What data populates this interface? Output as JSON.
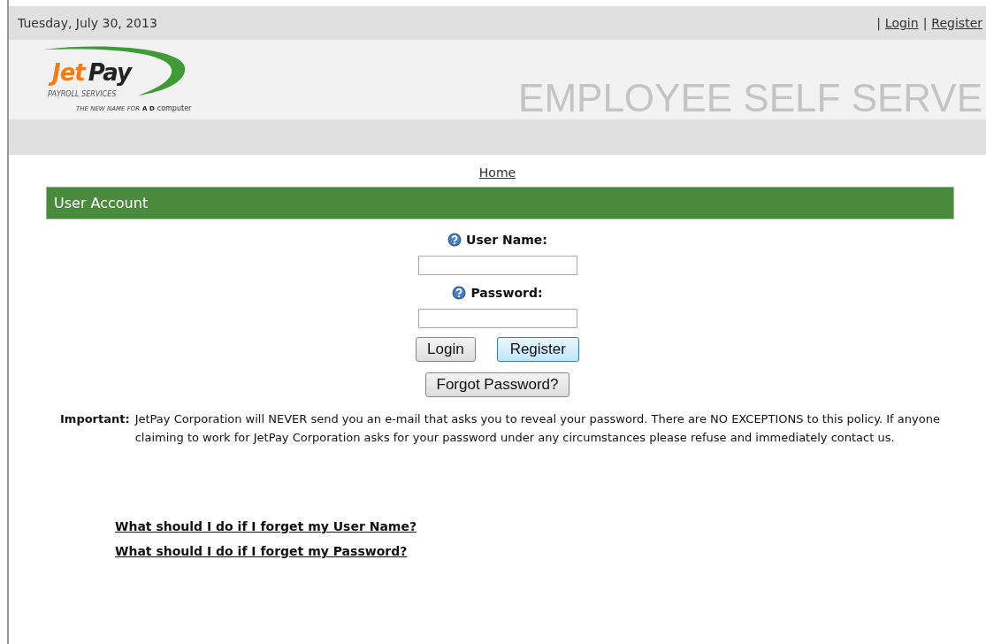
{
  "top_bar": {
    "date": "Tuesday, July 30, 2013",
    "separator_1": "|",
    "login_link": "Login",
    "separator_2": "|",
    "register_link": "Register"
  },
  "logo": {
    "name_1": "Jet",
    "name_2": "Pay",
    "subtitle": "PAYROLL SERVICES",
    "tagline": "THE NEW NAME FOR",
    "tagline_brand_1": "A D",
    "tagline_brand_2": "computer"
  },
  "banner_title": "EMPLOYEE SELF SERVE",
  "nav": {
    "home_link": "Home"
  },
  "panel": {
    "title": "User Account"
  },
  "fields": [
    {
      "label": "User Name:"
    },
    {
      "label": "Password:"
    }
  ],
  "buttons": [
    {
      "label": "Login",
      "highlighted": false
    },
    {
      "label": "Register",
      "highlighted": true
    }
  ],
  "forgot_button": "Forgot Password?",
  "notice": {
    "label": "Important:",
    "text": "JetPay Corporation will NEVER send you an e-mail that asks you to reveal your password. There are NO EXCEPTIONS to this policy. If anyone claiming to work for JetPay Corporation asks for your password under any circumstances please refuse and immediately contact us."
  },
  "help_links": [
    "What should I do if I forget my User Name?",
    "What should I do if I forget my Password?"
  ]
}
